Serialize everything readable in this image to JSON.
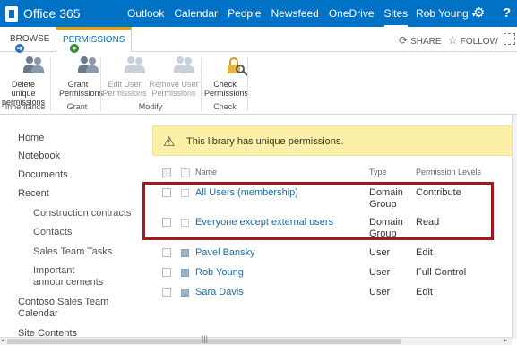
{
  "suite": {
    "brand": "Office 365",
    "nav": [
      "Outlook",
      "Calendar",
      "People",
      "Newsfeed",
      "OneDrive",
      "Sites"
    ],
    "more": "···",
    "user": "Rob Young",
    "help": "?"
  },
  "tabs": {
    "browse": "BROWSE",
    "permissions": "PERMISSIONS",
    "share": "SHARE",
    "follow": "FOLLOW"
  },
  "ribbon": {
    "delete_unique": [
      "Delete unique",
      "permissions"
    ],
    "grant": [
      "Grant",
      "Permissions"
    ],
    "edit_user": [
      "Edit User",
      "Permissions"
    ],
    "remove_user": [
      "Remove User",
      "Permissions"
    ],
    "check": [
      "Check",
      "Permissions"
    ],
    "groups": {
      "inheritance": "Inheritance",
      "grant": "Grant",
      "modify": "Modify",
      "check": "Check"
    }
  },
  "leftnav": {
    "home": "Home",
    "notebook": "Notebook",
    "documents": "Documents",
    "recent": "Recent",
    "recent_items": [
      "Construction contracts",
      "Contacts",
      "Sales Team Tasks",
      "Important announcements"
    ],
    "contoso": [
      "Contoso Sales Team",
      "Calendar"
    ],
    "site_contents": "Site Contents"
  },
  "notice": "This library has unique permissions.",
  "table": {
    "headers": {
      "name": "Name",
      "type": "Type",
      "levels": "Permission Levels"
    },
    "rows": [
      {
        "name": "All Users (membership)",
        "type": [
          "Domain",
          "Group"
        ],
        "level": "Contribute",
        "kind": "group"
      },
      {
        "name": "Everyone except external users",
        "type": [
          "Domain",
          "Group"
        ],
        "level": "Read",
        "kind": "group"
      },
      {
        "name": "Pavel Bansky",
        "type": [
          "User"
        ],
        "level": "Edit",
        "kind": "user"
      },
      {
        "name": "Rob Young",
        "type": [
          "User"
        ],
        "level": "Full Control",
        "kind": "user"
      },
      {
        "name": "Sara Davis",
        "type": [
          "User"
        ],
        "level": "Edit",
        "kind": "user"
      }
    ]
  },
  "colors": {
    "suite_bar": "#0072c6",
    "notice_bg": "#fcf0a6",
    "highlight_box": "#a8161e",
    "link": "#1f6ca8",
    "active_tab_accent": "#e8a300"
  }
}
